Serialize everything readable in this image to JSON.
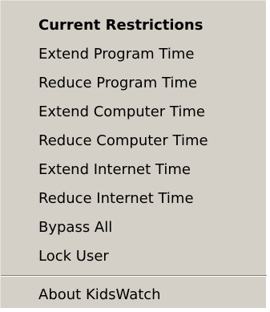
{
  "menu": {
    "items": [
      {
        "label": "Current Restrictions",
        "bold": true
      },
      {
        "label": "Extend Program Time"
      },
      {
        "label": "Reduce Program Time"
      },
      {
        "label": "Extend Computer Time"
      },
      {
        "label": "Reduce Computer Time"
      },
      {
        "label": "Extend Internet Time"
      },
      {
        "label": "Reduce Internet Time"
      },
      {
        "label": "Bypass All"
      },
      {
        "label": "Lock User"
      }
    ],
    "footer_items": [
      {
        "label": "About KidsWatch"
      }
    ]
  },
  "colors": {
    "menu_background": "#d4d0c8",
    "text": "#000000",
    "separator_dark": "#808080",
    "separator_light": "#ffffff"
  }
}
